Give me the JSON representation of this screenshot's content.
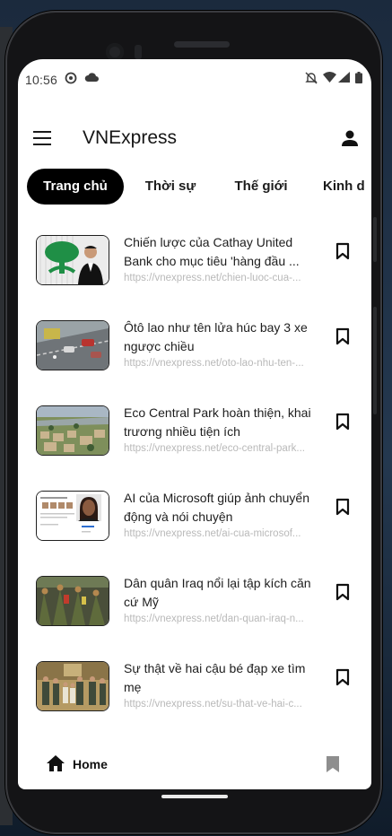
{
  "status_bar": {
    "time": "10:56",
    "icons": [
      "sync-icon",
      "cloud-icon",
      "mute-icon",
      "wifi-icon",
      "signal-icon",
      "battery-icon"
    ]
  },
  "app_bar": {
    "title": "VNExpress",
    "menu_icon": "menu-icon",
    "account_icon": "account-icon"
  },
  "tabs": [
    {
      "label": "Trang chủ",
      "active": true
    },
    {
      "label": "Thời sự",
      "active": false
    },
    {
      "label": "Thế giới",
      "active": false
    },
    {
      "label": "Kinh d",
      "active": false
    }
  ],
  "articles": [
    {
      "title": "Chiến lược của Cathay United Bank cho mục tiêu 'hàng đầu ...",
      "url": "https://vnexpress.net/chien-luoc-cua-...",
      "thumb": "tree-logo-portrait"
    },
    {
      "title": "Ôtô lao như tên lửa húc bay 3 xe ngược chiều",
      "url": "https://vnexpress.net/oto-lao-nhu-ten-...",
      "thumb": "road-traffic"
    },
    {
      "title": "Eco Central Park hoàn thiện, khai trương nhiều tiện ích",
      "url": "https://vnexpress.net/eco-central-park...",
      "thumb": "aerial-city"
    },
    {
      "title": "AI của Microsoft giúp ảnh chuyển động và nói chuyện",
      "url": "https://vnexpress.net/ai-cua-microsof...",
      "thumb": "webpage-portrait"
    },
    {
      "title": "Dân quân Iraq nổi lại tập kích căn cứ Mỹ",
      "url": "https://vnexpress.net/dan-quan-iraq-n...",
      "thumb": "militia-crowd"
    },
    {
      "title": "Sự thật về hai cậu bé đạp xe tìm mẹ",
      "url": "https://vnexpress.net/su-that-ve-hai-c...",
      "thumb": "people-group"
    }
  ],
  "bottom_nav": {
    "home_label": "Home",
    "home_icon": "home-icon",
    "saved_icon": "bookmark-icon"
  }
}
